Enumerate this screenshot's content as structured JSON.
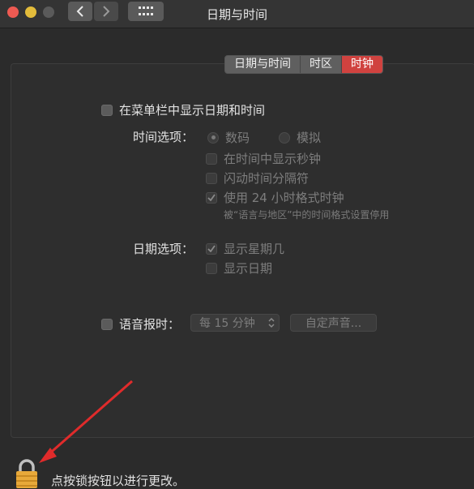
{
  "window": {
    "title": "日期与时间"
  },
  "tabs": [
    {
      "label": "日期与时间",
      "active": false
    },
    {
      "label": "时区",
      "active": false
    },
    {
      "label": "时钟",
      "active": true
    }
  ],
  "menubar": {
    "label": "在菜单栏中显示日期和时间",
    "checked": false
  },
  "time_options": {
    "label": "时间选项：",
    "digital": "数码",
    "analog": "模拟",
    "show_seconds": "在时间中显示秒钟",
    "flash_separators": "闪动时间分隔符",
    "use_24h": "使用 24 小时格式时钟",
    "use_24h_note": "被“语言与地区”中的时间格式设置停用"
  },
  "date_options": {
    "label": "日期选项：",
    "show_weekday": "显示星期几",
    "show_date": "显示日期"
  },
  "announce": {
    "label": "语音报时：",
    "interval": "每 15 分钟",
    "custom_voice": "自定声音..."
  },
  "footer": {
    "lock_text": "点按锁按钮以进行更改。"
  },
  "colors": {
    "accent": "#d0423f",
    "arrow": "#e02b2b",
    "lock": "#e8a93a"
  }
}
